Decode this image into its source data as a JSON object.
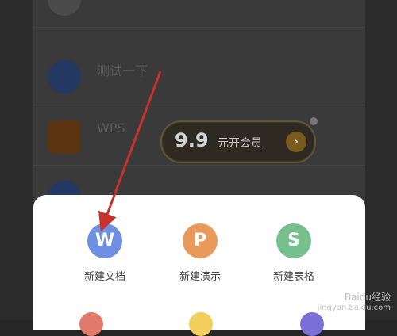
{
  "top_row": {
    "title": "",
    "meta": ""
  },
  "doc_list": [
    {
      "title": "测试一下",
      "subtitle": ""
    },
    {
      "title": "WPS",
      "subtitle": ""
    },
    {
      "title": "",
      "subtitle": ""
    }
  ],
  "vip_badge": {
    "price": "9.9",
    "text": "元开会员",
    "arrow": "›"
  },
  "new_sheet": {
    "items": [
      {
        "glyph": "W",
        "label": "新建文档",
        "color": "#6f8fe3"
      },
      {
        "glyph": "P",
        "label": "新建演示",
        "color": "#e9995b"
      },
      {
        "glyph": "S",
        "label": "新建表格",
        "color": "#77c08e"
      }
    ]
  },
  "annotation": {
    "arrow_color": "#c8322c"
  },
  "watermark": {
    "line1": "Baidu经验",
    "line2": "jingyan.baidu.com"
  }
}
